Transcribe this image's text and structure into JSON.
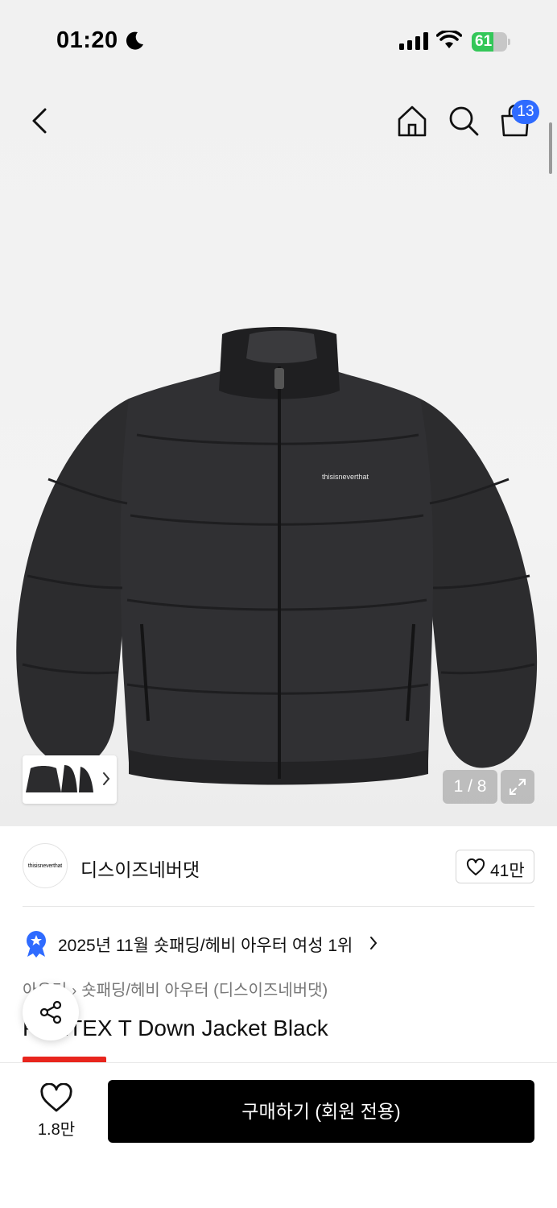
{
  "status_bar": {
    "time": "01:20",
    "battery_level": "61",
    "battery_fraction": 0.61
  },
  "nav": {
    "cart_count": "13"
  },
  "gallery": {
    "page_counter": "1 / 8",
    "jacket_logo_text": "thisisneverthat"
  },
  "brand": {
    "logo_text": "thisisneverthat",
    "name": "디스이즈네버댓",
    "likes": "41만"
  },
  "ranking": {
    "text": "2025년 11월 숏패딩/헤비 아우터 여성 1위"
  },
  "breadcrumb": {
    "level1": "아우터",
    "level2": "숏패딩/헤비 아우터 (디스이즈네버댓)"
  },
  "product": {
    "title": "PERTEX T Down Jacket Black"
  },
  "bottom_bar": {
    "wish_count": "1.8만",
    "buy_label": "구매하기 (회원 전용)"
  },
  "colors": {
    "buy_button": "#000000",
    "cart_badge": "#2f6bff",
    "sale_tag": "#e8251d",
    "battery_fill": "#34c759"
  }
}
